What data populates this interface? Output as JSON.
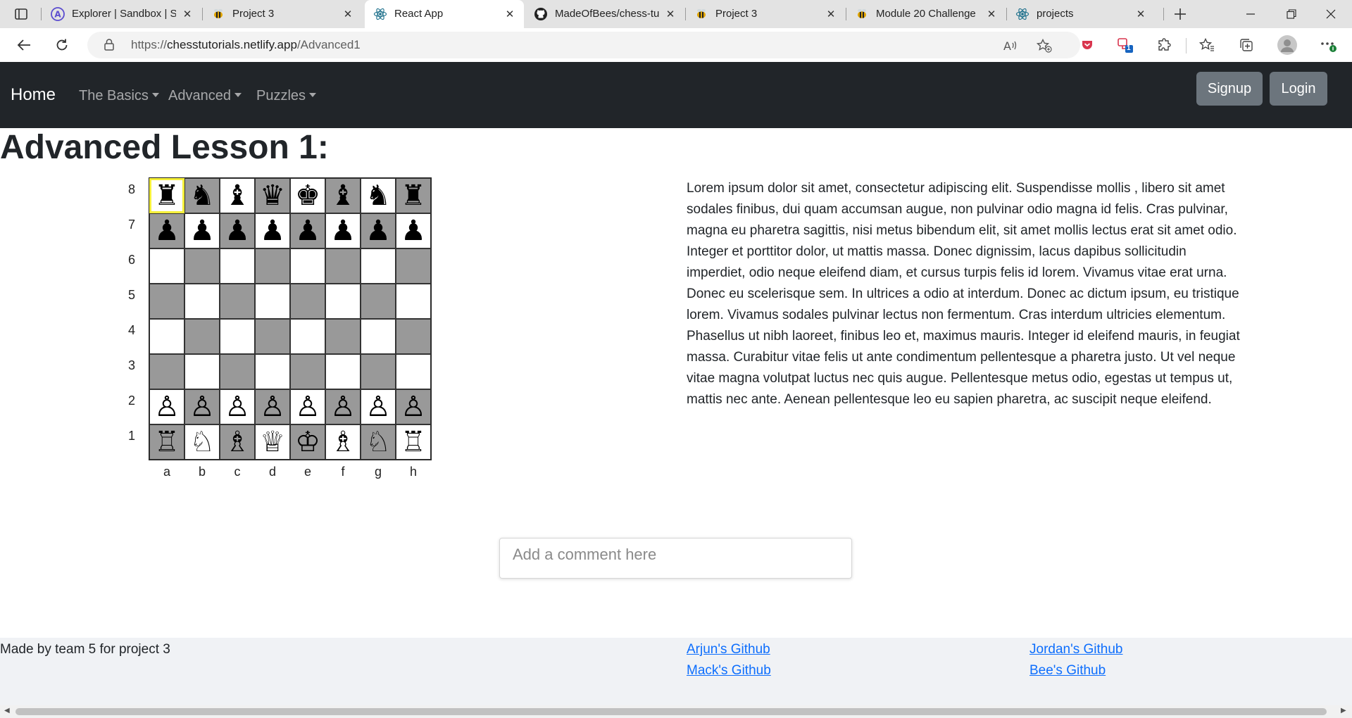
{
  "browser": {
    "tabs": [
      {
        "title": "Explorer | Sandbox | St",
        "icon": "apollo-icon"
      },
      {
        "title": "Project 3",
        "icon": "bee-icon"
      },
      {
        "title": "React App",
        "icon": "react-icon",
        "active": true
      },
      {
        "title": "MadeOfBees/chess-tu",
        "icon": "github-icon"
      },
      {
        "title": "Project 3",
        "icon": "bee-icon"
      },
      {
        "title": "Module 20 Challenge",
        "icon": "bee-icon"
      },
      {
        "title": "projects",
        "icon": "react-icon"
      }
    ],
    "address": {
      "prefix": "https://",
      "host": "chesstutorials.netlify.app",
      "path": "/Advanced1"
    },
    "extension_badge": "1"
  },
  "navbar": {
    "brand": "Home",
    "menus": [
      "The Basics",
      "Advanced",
      "Puzzles"
    ],
    "signup": "Signup",
    "login": "Login"
  },
  "page": {
    "title": "Advanced Lesson 1:",
    "board": {
      "ranks": [
        "8",
        "7",
        "6",
        "5",
        "4",
        "3",
        "2",
        "1"
      ],
      "files": [
        "a",
        "b",
        "c",
        "d",
        "e",
        "f",
        "g",
        "h"
      ],
      "rows": [
        [
          "♜",
          "♞",
          "♝",
          "♛",
          "♚",
          "♝",
          "♞",
          "♜"
        ],
        [
          "♟",
          "♟",
          "♟",
          "♟",
          "♟",
          "♟",
          "♟",
          "♟"
        ],
        [
          "",
          "",
          "",
          "",
          "",
          "",
          "",
          ""
        ],
        [
          "",
          "",
          "",
          "",
          "",
          "",
          "",
          ""
        ],
        [
          "",
          "",
          "",
          "",
          "",
          "",
          "",
          ""
        ],
        [
          "",
          "",
          "",
          "",
          "",
          "",
          "",
          ""
        ],
        [
          "♙",
          "♙",
          "♙",
          "♙",
          "♙",
          "♙",
          "♙",
          "♙"
        ],
        [
          "♖",
          "♘",
          "♗",
          "♕",
          "♔",
          "♗",
          "♘",
          "♖"
        ]
      ],
      "selected_square": "a8"
    },
    "lesson_text": "Lorem ipsum dolor sit amet, consectetur adipiscing elit. Suspendisse mollis , libero sit amet sodales finibus, dui quam accumsan augue, non pulvinar odio magna id felis. Cras pulvinar, magna eu pharetra sagittis, nisi metus bibendum elit, sit amet mollis lectus erat sit amet odio. Integer et porttitor dolor, ut mattis massa. Donec dignissim, lacus dapibus sollicitudin imperdiet, odio neque eleifend diam, et cursus turpis felis id lorem. Vivamus vitae erat urna. Donec eu scelerisque sem. In ultrices a odio at interdum. Donec ac dictum ipsum, eu tristique lorem. Vivamus sodales pulvinar lectus non fermentum. Cras interdum ultricies elementum. Phasellus ut nibh laoreet, finibus leo et, maximus mauris. Integer id eleifend mauris, in feugiat massa. Curabitur vitae felis ut ante condimentum pellentesque a pharetra justo. Ut vel neque vitae magna volutpat luctus nec quis augue. Pellentesque metus odio, egestas ut tempus ut, mattis nec ante. Aenean pellentesque leo eu sapien pharetra, ac suscipit neque eleifend.",
    "comment_placeholder": "Add a comment here"
  },
  "footer": {
    "credit": "Made by team 5 for project 3",
    "links": [
      "Arjun's Github",
      "Mack's Github",
      "Jordan's Github",
      "Bee's Github"
    ]
  },
  "colors": {
    "navbar_bg": "#212529",
    "button_bg": "#6c757d",
    "dark_square": "#999999",
    "light_square": "#ffffff",
    "selected_outline": "#f5f03a",
    "link": "#0d6efd",
    "footer_bg": "#f0f2f5"
  }
}
